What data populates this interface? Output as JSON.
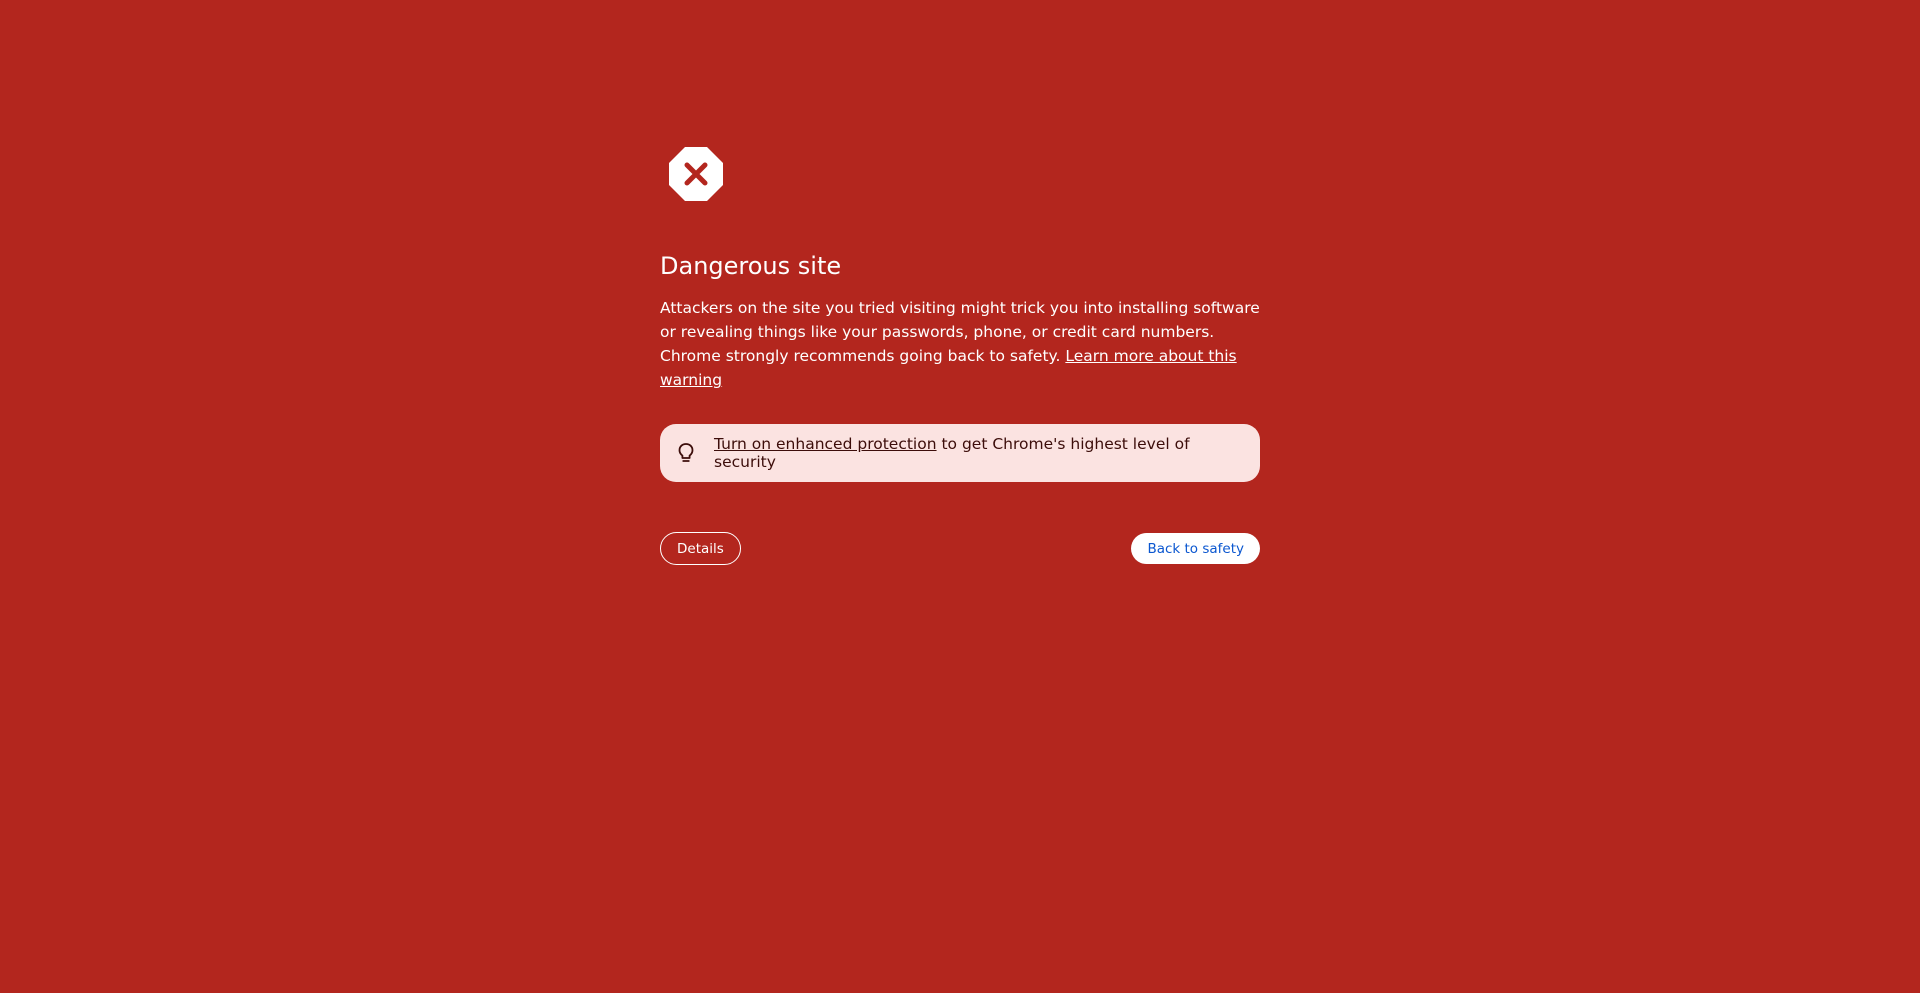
{
  "page": {
    "background_color": "#b3261e",
    "icon": "stop-x-icon",
    "title": "Dangerous site",
    "description": "Attackers on the site you tried visiting might trick you into installing software or revealing things like your passwords, phone, or credit card numbers. Chrome strongly recommends going back to safety.",
    "learn_more_link": "Learn more about this warning"
  },
  "promo": {
    "icon": "lightbulb-icon",
    "link_text": "Turn on enhanced protection",
    "trailing_text": " to get Chrome's highest level of security",
    "background_color": "#fbe3e1"
  },
  "buttons": {
    "details_label": "Details",
    "back_label": "Back to safety",
    "back_text_color": "#0b57d0"
  }
}
